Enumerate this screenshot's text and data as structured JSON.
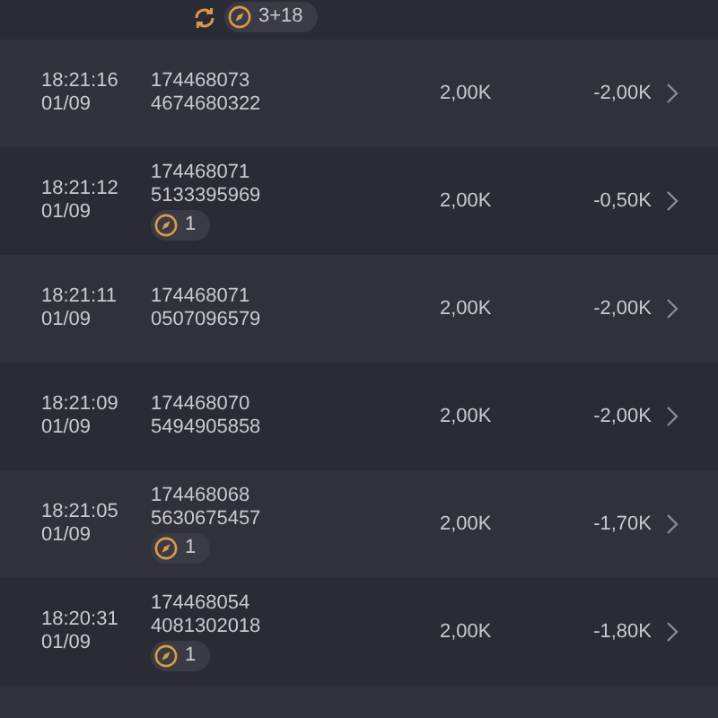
{
  "rows": [
    {
      "tags": [
        {
          "kind": "sync"
        },
        {
          "kind": "badge",
          "text": "3+18"
        }
      ]
    },
    {
      "time": "18:21:16",
      "date": "01/09",
      "ids": [
        "174468073",
        "4674680322"
      ],
      "tags": [],
      "amount": "2,00K",
      "change": "-2,00K"
    },
    {
      "time": "18:21:12",
      "date": "01/09",
      "ids": [
        "174468071",
        "5133395969"
      ],
      "tags": [
        {
          "kind": "badge",
          "text": "1"
        }
      ],
      "amount": "2,00K",
      "change": "-0,50K"
    },
    {
      "time": "18:21:11",
      "date": "01/09",
      "ids": [
        "174468071",
        "0507096579"
      ],
      "tags": [],
      "amount": "2,00K",
      "change": "-2,00K"
    },
    {
      "time": "18:21:09",
      "date": "01/09",
      "ids": [
        "174468070",
        "5494905858"
      ],
      "tags": [],
      "amount": "2,00K",
      "change": "-2,00K"
    },
    {
      "time": "18:21:05",
      "date": "01/09",
      "ids": [
        "174468068",
        "5630675457"
      ],
      "tags": [
        {
          "kind": "badge",
          "text": "1"
        }
      ],
      "amount": "2,00K",
      "change": "-1,70K"
    },
    {
      "time": "18:20:31",
      "date": "01/09",
      "ids": [
        "174468054",
        "4081302018"
      ],
      "tags": [
        {
          "kind": "badge",
          "text": "1"
        }
      ],
      "amount": "2,00K",
      "change": "-1,80K"
    },
    {
      "kind": "empty"
    }
  ]
}
